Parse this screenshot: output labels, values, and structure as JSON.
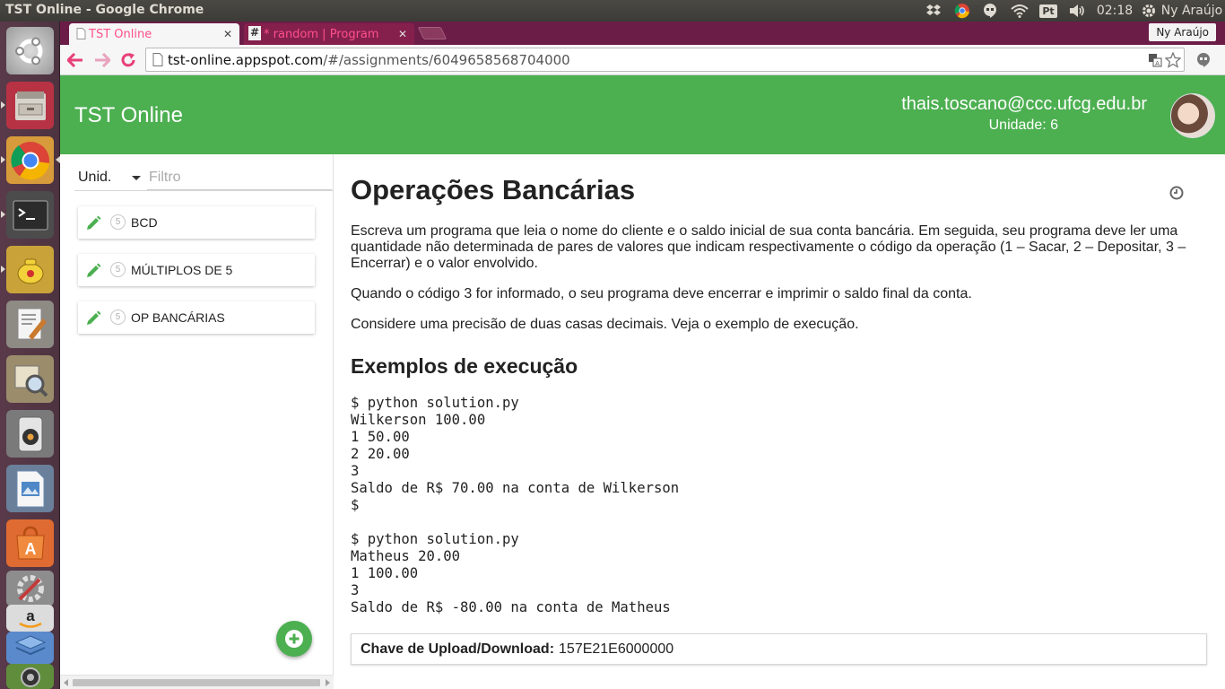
{
  "os": {
    "window_title": "TST Online - Google Chrome",
    "clock": "02:18",
    "user": "Ny Araújo",
    "keyboard_layout": "Pt"
  },
  "browser": {
    "tabs": [
      {
        "label": "TST Online",
        "active": true
      },
      {
        "label": "* random | Program",
        "active": false
      }
    ],
    "profile_name": "Ny Araújo",
    "url_host": "tst-online.appspot.com",
    "url_path": "/#/assignments/6049658568704000"
  },
  "header": {
    "app_title": "TST Online",
    "user_email": "thais.toscano@ccc.ufcg.edu.br",
    "user_unit": "Unidade: 6"
  },
  "sidebar": {
    "unit_select": "Unid.",
    "filter_placeholder": "Filtro",
    "assignments": [
      {
        "unit": "5",
        "title": "BCD"
      },
      {
        "unit": "5",
        "title": "MÚLTIPLOS DE 5"
      },
      {
        "unit": "5",
        "title": "OP BANCÁRIAS"
      }
    ]
  },
  "main": {
    "title": "Operações Bancárias",
    "paragraphs": [
      "Escreva um programa que leia o nome do cliente e o saldo inicial de sua conta bancária. Em seguida, seu programa deve ler uma quantidade não determinada de pares de valores que indicam respectivamente o código da operação (1 – Sacar, 2 – Depositar, 3 – Encerrar) e o valor envolvido.",
      "Quando o código 3 for informado, o seu programa deve encerrar e imprimir o saldo final da conta.",
      "Considere uma precisão de duas casas decimais. Veja o exemplo de execução."
    ],
    "examples_heading": "Exemplos de execução",
    "example_1": "$ python solution.py\nWilkerson 100.00\n1 50.00\n2 20.00\n3\nSaldo de R$ 70.00 na conta de Wilkerson\n$",
    "example_2": "$ python solution.py\nMatheus 20.00\n1 100.00\n3\nSaldo de R$ -80.00 na conta de Matheus",
    "key_label": "Chave de Upload/Download:",
    "key_value": "157E21E6000000"
  },
  "colors": {
    "header_green": "#4caf50",
    "tab_accent": "#ff4f8b",
    "chrome_frame": "#6b1d47"
  }
}
